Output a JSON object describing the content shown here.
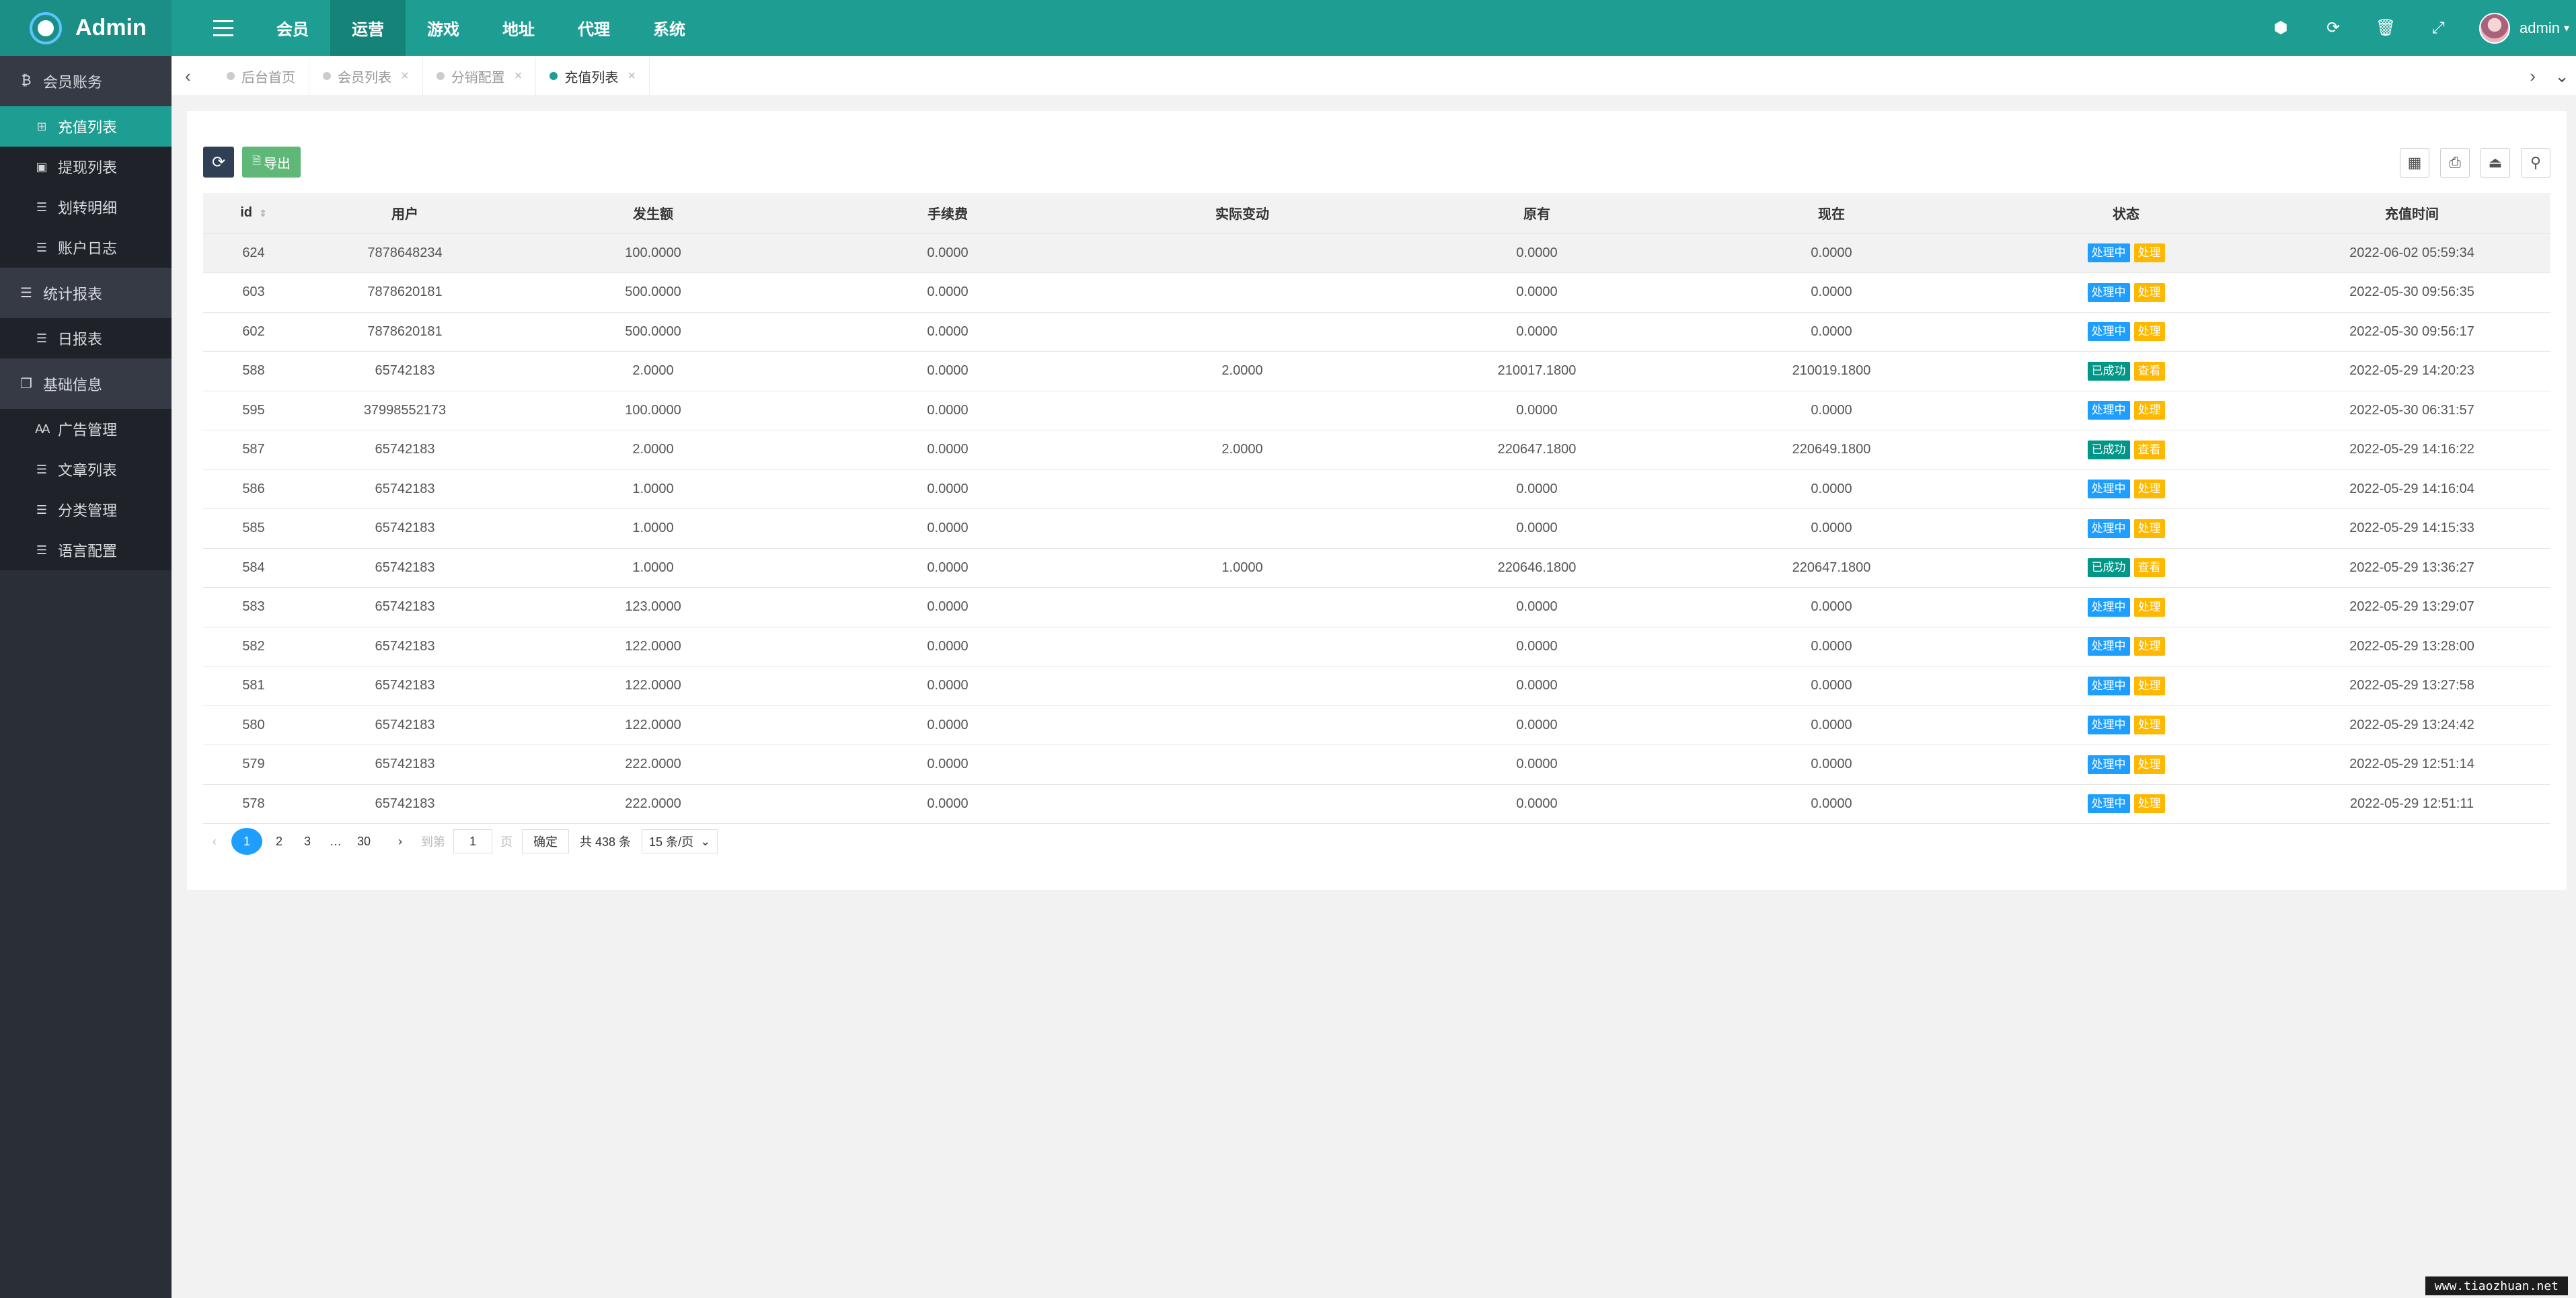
{
  "brand": {
    "title": "Admin"
  },
  "topnav": {
    "items": [
      "会员",
      "运营",
      "游戏",
      "地址",
      "代理",
      "系统"
    ],
    "active": "运营"
  },
  "user": {
    "name": "admin"
  },
  "sidebar": {
    "groups": [
      {
        "label": "会员账务",
        "icon": "bitcoin-icon",
        "items": [
          "充值列表",
          "提现列表",
          "划转明细",
          "账户日志"
        ]
      },
      {
        "label": "统计报表",
        "icon": "list-icon",
        "items": [
          "日报表"
        ]
      },
      {
        "label": "基础信息",
        "icon": "copy-icon",
        "items": [
          "广告管理",
          "文章列表",
          "分类管理",
          "语言配置"
        ]
      }
    ],
    "active_item": "充值列表"
  },
  "tabs": [
    "后台首页",
    "会员列表",
    "分销配置",
    "充值列表"
  ],
  "toolbar": {
    "export_label": "导出"
  },
  "table": {
    "columns": [
      "id",
      "用户",
      "发生额",
      "手续费",
      "实际变动",
      "原有",
      "现在",
      "状态",
      "充值时间"
    ],
    "rows": [
      [
        "624",
        "7878648234",
        "100.0000",
        "0.0000",
        "",
        "0.0000",
        "0.0000",
        "处理中",
        "处理",
        "2022-06-02 05:59:34"
      ],
      [
        "603",
        "7878620181",
        "500.0000",
        "0.0000",
        "",
        "0.0000",
        "0.0000",
        "处理中",
        "处理",
        "2022-05-30 09:56:35"
      ],
      [
        "602",
        "7878620181",
        "500.0000",
        "0.0000",
        "",
        "0.0000",
        "0.0000",
        "处理中",
        "处理",
        "2022-05-30 09:56:17"
      ],
      [
        "588",
        "65742183",
        "2.0000",
        "0.0000",
        "2.0000",
        "210017.1800",
        "210019.1800",
        "已成功",
        "查看",
        "2022-05-29 14:20:23"
      ],
      [
        "595",
        "37998552173",
        "100.0000",
        "0.0000",
        "",
        "0.0000",
        "0.0000",
        "处理中",
        "处理",
        "2022-05-30 06:31:57"
      ],
      [
        "587",
        "65742183",
        "2.0000",
        "0.0000",
        "2.0000",
        "220647.1800",
        "220649.1800",
        "已成功",
        "查看",
        "2022-05-29 14:16:22"
      ],
      [
        "586",
        "65742183",
        "1.0000",
        "0.0000",
        "",
        "0.0000",
        "0.0000",
        "处理中",
        "处理",
        "2022-05-29 14:16:04"
      ],
      [
        "585",
        "65742183",
        "1.0000",
        "0.0000",
        "",
        "0.0000",
        "0.0000",
        "处理中",
        "处理",
        "2022-05-29 14:15:33"
      ],
      [
        "584",
        "65742183",
        "1.0000",
        "0.0000",
        "1.0000",
        "220646.1800",
        "220647.1800",
        "已成功",
        "查看",
        "2022-05-29 13:36:27"
      ],
      [
        "583",
        "65742183",
        "123.0000",
        "0.0000",
        "",
        "0.0000",
        "0.0000",
        "处理中",
        "处理",
        "2022-05-29 13:29:07"
      ],
      [
        "582",
        "65742183",
        "122.0000",
        "0.0000",
        "",
        "0.0000",
        "0.0000",
        "处理中",
        "处理",
        "2022-05-29 13:28:00"
      ],
      [
        "581",
        "65742183",
        "122.0000",
        "0.0000",
        "",
        "0.0000",
        "0.0000",
        "处理中",
        "处理",
        "2022-05-29 13:27:58"
      ],
      [
        "580",
        "65742183",
        "122.0000",
        "0.0000",
        "",
        "0.0000",
        "0.0000",
        "处理中",
        "处理",
        "2022-05-29 13:24:42"
      ],
      [
        "579",
        "65742183",
        "222.0000",
        "0.0000",
        "",
        "0.0000",
        "0.0000",
        "处理中",
        "处理",
        "2022-05-29 12:51:14"
      ],
      [
        "578",
        "65742183",
        "222.0000",
        "0.0000",
        "",
        "0.0000",
        "0.0000",
        "处理中",
        "处理",
        "2022-05-29 12:51:11"
      ]
    ]
  },
  "pager": {
    "pages": [
      "1",
      "2",
      "3"
    ],
    "ellipsis": "…",
    "last": "30",
    "goto_prefix": "到第",
    "goto_value": "1",
    "goto_suffix": "页",
    "confirm": "确定",
    "total": "共 438 条",
    "per_page": "15 条/页"
  },
  "watermark": "www.tiaozhuan.net"
}
